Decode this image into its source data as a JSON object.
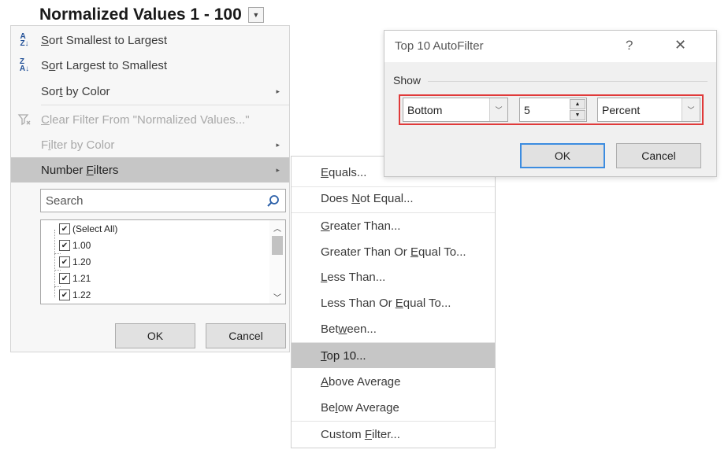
{
  "header": {
    "title": "Normalized Values 1 - 100"
  },
  "menu": {
    "sort_asc": "Sort Smallest to Largest",
    "sort_desc": "Sort Largest to Smallest",
    "sort_color": "Sort by Color",
    "clear_filter": "Clear Filter From \"Normalized Values...\"",
    "filter_color": "Filter by Color",
    "number_filters": "Number Filters",
    "search_placeholder": "Search",
    "list_items": [
      "(Select All)",
      "1.00",
      "1.20",
      "1.21",
      "1.22"
    ],
    "ok": "OK",
    "cancel": "Cancel"
  },
  "submenu": {
    "items": [
      "Equals...",
      "Does Not Equal...",
      "Greater Than...",
      "Greater Than Or Equal To...",
      "Less Than...",
      "Less Than Or Equal To...",
      "Between...",
      "Top 10...",
      "Above Average",
      "Below Average",
      "Custom Filter..."
    ]
  },
  "dialog": {
    "title": "Top 10 AutoFilter",
    "help": "?",
    "close": "✕",
    "group": "Show",
    "type_value": "Bottom",
    "count_value": "5",
    "unit_value": "Percent",
    "ok": "OK",
    "cancel": "Cancel"
  },
  "colors": {
    "highlight": "#c6c6c6",
    "red_outline": "#e03a3a",
    "primary_border": "#3c8ce0"
  }
}
